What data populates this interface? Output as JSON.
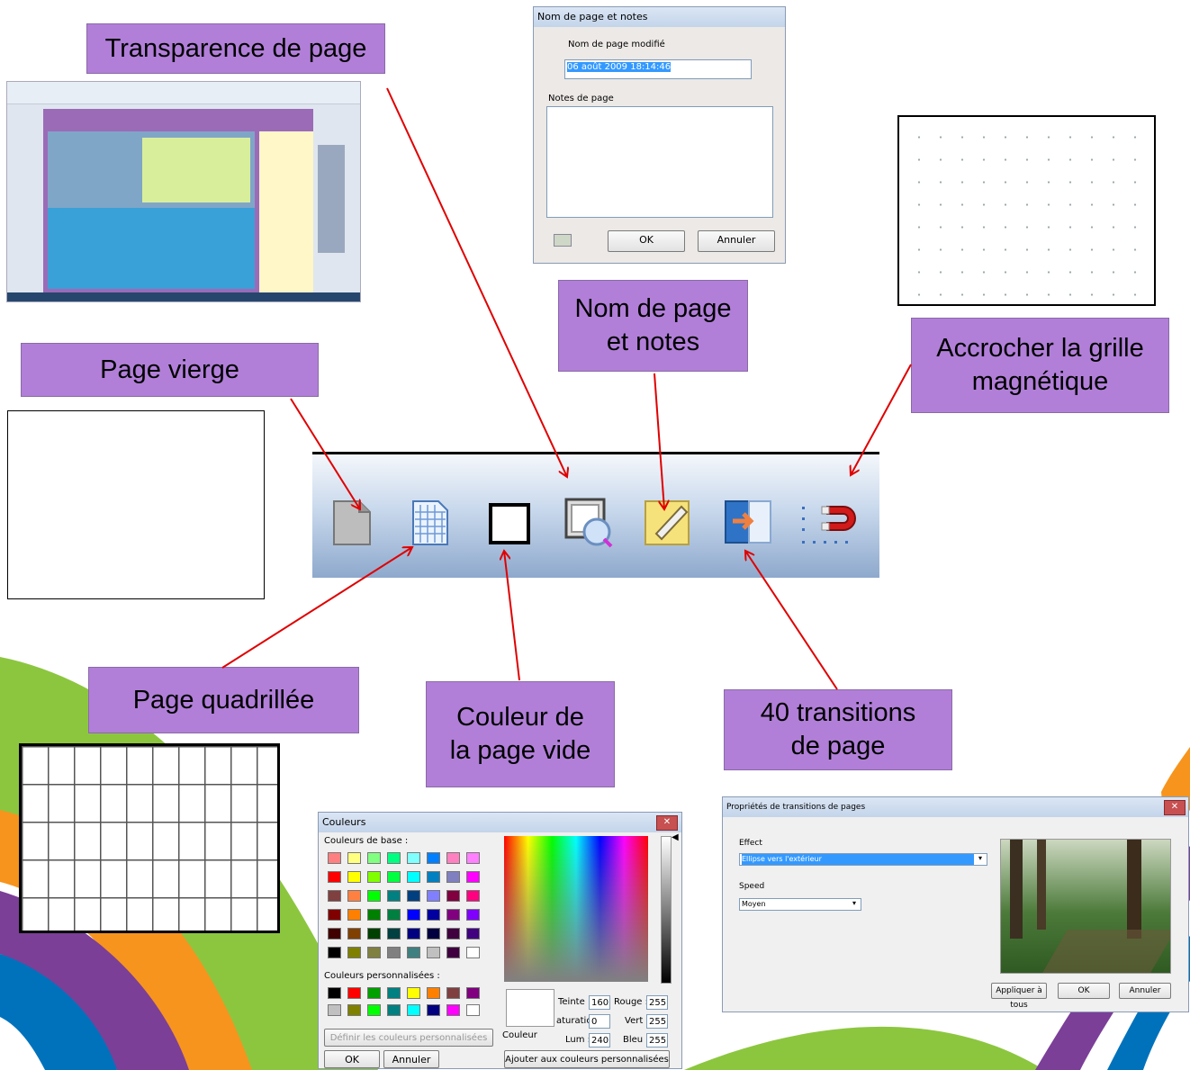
{
  "labels": {
    "transparence": "Transparence de page",
    "page_vierge": "Page vierge",
    "nom_page_line1": "Nom de page",
    "nom_page_line2": "et notes",
    "accrocher_line1": "Accrocher la grille",
    "accrocher_line2": "magnétique",
    "page_quadrillee": "Page quadrillée",
    "couleur_line1": "Couleur de",
    "couleur_line2": "la page vide",
    "transitions_line1": "40 transitions",
    "transitions_line2": "de page"
  },
  "toolbar": {
    "icons": [
      "blank-page-icon",
      "grid-page-icon",
      "page-color-icon",
      "page-transparency-icon",
      "page-notes-icon",
      "page-transition-icon",
      "magnetic-grid-icon"
    ]
  },
  "notes_dialog": {
    "title": "Nom de page et notes",
    "name_label": "Nom de page modifié",
    "name_value": "06 août 2009 18:14:46",
    "notes_label": "Notes de page",
    "ok": "OK",
    "cancel": "Annuler"
  },
  "color_dialog": {
    "title": "Couleurs",
    "basic_label": "Couleurs de base :",
    "custom_label": "Couleurs personnalisées :",
    "define_button": "Définir les couleurs personnalisées >>",
    "ok": "OK",
    "cancel": "Annuler",
    "color_label": "Couleur",
    "hue_label": "Teinte :",
    "hue": "160",
    "sat_label": "aturation",
    "sat": "0",
    "lum_label": "Lum :",
    "lum": "240",
    "red_label": "Rouge :",
    "red": "255",
    "green_label": "Vert :",
    "green": "255",
    "blue_label": "Bleu :",
    "blue": "255",
    "add_button": "Ajouter aux couleurs personnalisées",
    "basic_colors": [
      [
        "#ff8080",
        "#ffff80",
        "#80ff80",
        "#00ff80",
        "#80ffff",
        "#0080ff",
        "#ff80c0",
        "#ff80ff"
      ],
      [
        "#ff0000",
        "#ffff00",
        "#80ff00",
        "#00ff40",
        "#00ffff",
        "#0080c0",
        "#8080c0",
        "#ff00ff"
      ],
      [
        "#804040",
        "#ff8040",
        "#00ff00",
        "#008080",
        "#004080",
        "#8080ff",
        "#800040",
        "#ff0080"
      ],
      [
        "#800000",
        "#ff8000",
        "#008000",
        "#008040",
        "#0000ff",
        "#0000a0",
        "#800080",
        "#8000ff"
      ],
      [
        "#400000",
        "#804000",
        "#004000",
        "#004040",
        "#000080",
        "#000040",
        "#400040",
        "#400080"
      ],
      [
        "#000000",
        "#808000",
        "#808040",
        "#808080",
        "#408080",
        "#c0c0c0",
        "#400040",
        "#ffffff"
      ]
    ],
    "custom_colors": [
      [
        "#000000",
        "#ff0000",
        "#00a000",
        "#008080",
        "#ffff00",
        "#ff8000",
        "#804040",
        "#800080"
      ],
      [
        "#c0c0c0",
        "#808000",
        "#00ff00",
        "#008080",
        "#00ffff",
        "#000080",
        "#ff00ff",
        "#ffffff"
      ]
    ]
  },
  "transition_dialog": {
    "title": "Propriétés de transitions de pages",
    "effect_label": "Effect",
    "effect_value": "Ellipse vers l'extérieur",
    "speed_label": "Speed",
    "speed_value": "Moyen",
    "apply_all": "Appliquer à tous",
    "ok": "OK",
    "cancel": "Annuler"
  }
}
